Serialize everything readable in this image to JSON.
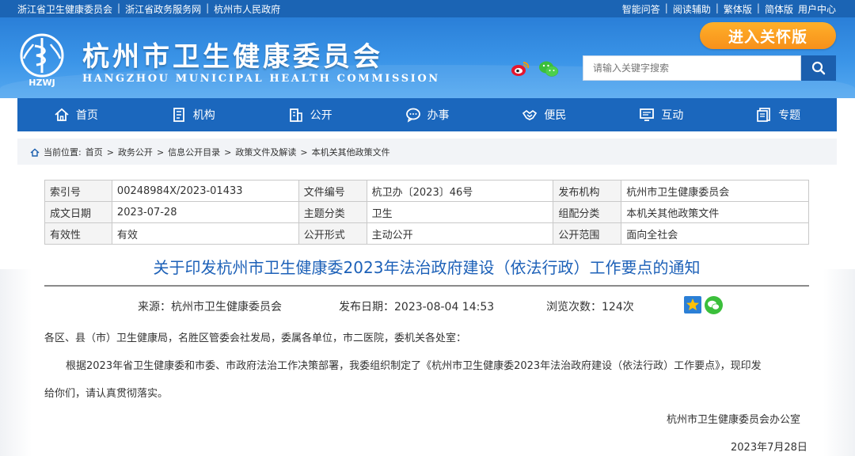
{
  "topbar": {
    "left_links": [
      "浙江省卫生健康委员会",
      "浙江省政务服务网",
      "杭州市人民政府"
    ],
    "right_links": [
      "智能问答",
      "阅读辅助",
      "繁体版",
      "简体版",
      "用户中心"
    ]
  },
  "header": {
    "logo_text": "HZWJ",
    "title_cn": "杭州市卫生健康委员会",
    "title_en": "HANGZHOU MUNICIPAL HEALTH COMMISSION",
    "care_button": "进入关怀版",
    "search_placeholder": "请输入关键字搜索",
    "icons": [
      "weibo-icon",
      "wechat-icon",
      "search-icon"
    ]
  },
  "nav": {
    "items": [
      {
        "label": "首页",
        "icon": "home-icon"
      },
      {
        "label": "机构",
        "icon": "org-icon"
      },
      {
        "label": "公开",
        "icon": "building-icon"
      },
      {
        "label": "办事",
        "icon": "chat-icon"
      },
      {
        "label": "便民",
        "icon": "handshake-icon"
      },
      {
        "label": "互动",
        "icon": "monitor-icon"
      },
      {
        "label": "专题",
        "icon": "document-icon"
      }
    ]
  },
  "breadcrumb": {
    "prefix": "当前位置:",
    "items": [
      "首页",
      "政务公开",
      "信息公开目录",
      "政策文件及解读",
      "本机关其他政策文件"
    ]
  },
  "meta": {
    "rows": [
      [
        {
          "label": "索引号",
          "value": "00248984X/2023-01433"
        },
        {
          "label": "文件编号",
          "value": "杭卫办〔2023〕46号"
        },
        {
          "label": "发布机构",
          "value": "杭州市卫生健康委员会"
        }
      ],
      [
        {
          "label": "成文日期",
          "value": "2023-07-28"
        },
        {
          "label": "主题分类",
          "value": "卫生"
        },
        {
          "label": "组配分类",
          "value": "本机关其他政策文件"
        }
      ],
      [
        {
          "label": "有效性",
          "value": "有效"
        },
        {
          "label": "公开形式",
          "value": "主动公开"
        },
        {
          "label": "公开范围",
          "value": "面向全社会"
        }
      ]
    ]
  },
  "article": {
    "title": "关于印发杭州市卫生健康委2023年法治政府建设（依法行政）工作要点的通知",
    "source": "来源：杭州市卫生健康委员会",
    "publish_time": "发布日期：2023-08-04 14:53",
    "views": "浏览次数：124次",
    "salutation": "各区、县（市）卫生健康局，名胜区管委会社发局，委属各单位，市二医院，委机关各处室：",
    "para1_line1": "根据2023年省卫生健康委和市委、市政府法治工作决策部署，我委组织制定了《杭州市卫生健康委2023年法治政府建设（依法行政）工作要点》，现印发",
    "para1_line2": "给你们，请认真贯彻落实。",
    "signature": "杭州市卫生健康委员会办公室",
    "date": "2023年7月28日"
  },
  "colors": {
    "nav_blue": "#1b67bd",
    "title_blue": "#1d61b8",
    "care_orange": "#f7901a"
  }
}
